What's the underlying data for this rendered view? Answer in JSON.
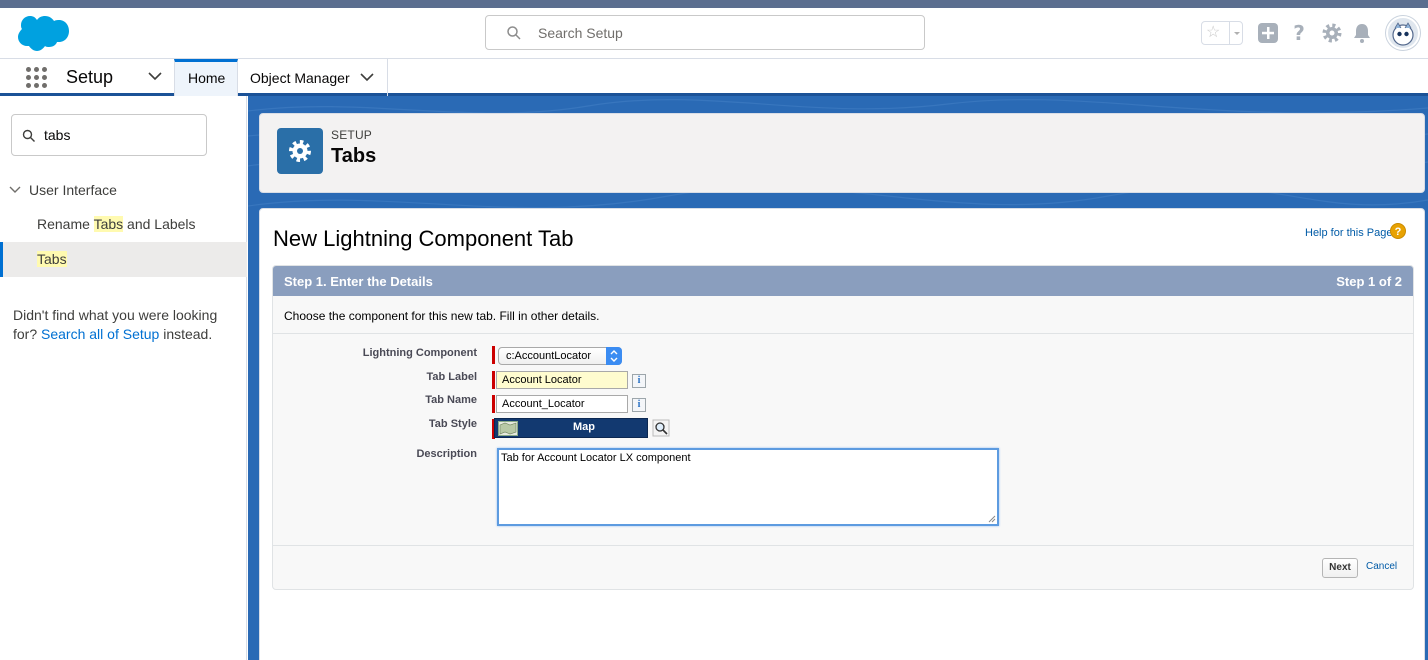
{
  "header": {
    "search_placeholder": "Search Setup",
    "icons": [
      "favorites-star-icon",
      "add-icon",
      "help-icon",
      "setup-gear-icon",
      "notifications-bell-icon",
      "user-avatar"
    ]
  },
  "nav": {
    "app_name": "Setup",
    "tabs": [
      {
        "label": "Home",
        "active": true
      },
      {
        "label": "Object Manager",
        "has_menu": true
      }
    ]
  },
  "sidebar": {
    "quick_find_value": "tabs",
    "tree_parent": "User Interface",
    "items": [
      {
        "prefix": "Rename ",
        "highlight": "Tabs",
        "suffix": " and Labels",
        "selected": false
      },
      {
        "prefix": "",
        "highlight": "Tabs",
        "suffix": "",
        "selected": true
      }
    ],
    "not_found_text": "Didn't find what you were looking for? ",
    "not_found_link": "Search all of Setup",
    "not_found_suffix": " instead."
  },
  "setup_header": {
    "kicker": "SETUP",
    "title": "Tabs"
  },
  "page": {
    "title": "New Lightning Component Tab",
    "help_link": "Help for this Page",
    "step_title": "Step 1. Enter the Details",
    "step_counter": "Step 1 of 2",
    "instructions": "Choose the component for this new tab. Fill in other details.",
    "fields": {
      "component_label": "Lightning Component",
      "component_value": "c:AccountLocator",
      "tab_label_label": "Tab Label",
      "tab_label_value": "Account Locator",
      "tab_name_label": "Tab Name",
      "tab_name_value": "Account_Locator",
      "tab_style_label": "Tab Style",
      "tab_style_value": "Map",
      "description_label": "Description",
      "description_value": "Tab for Account Locator LX component"
    },
    "buttons": {
      "next": "Next",
      "cancel": "Cancel"
    }
  },
  "colors": {
    "brand_blue": "#0070d2",
    "block_header": "#8a9ebe",
    "required_bar": "#cc0000",
    "highlight": "#fffab0"
  }
}
